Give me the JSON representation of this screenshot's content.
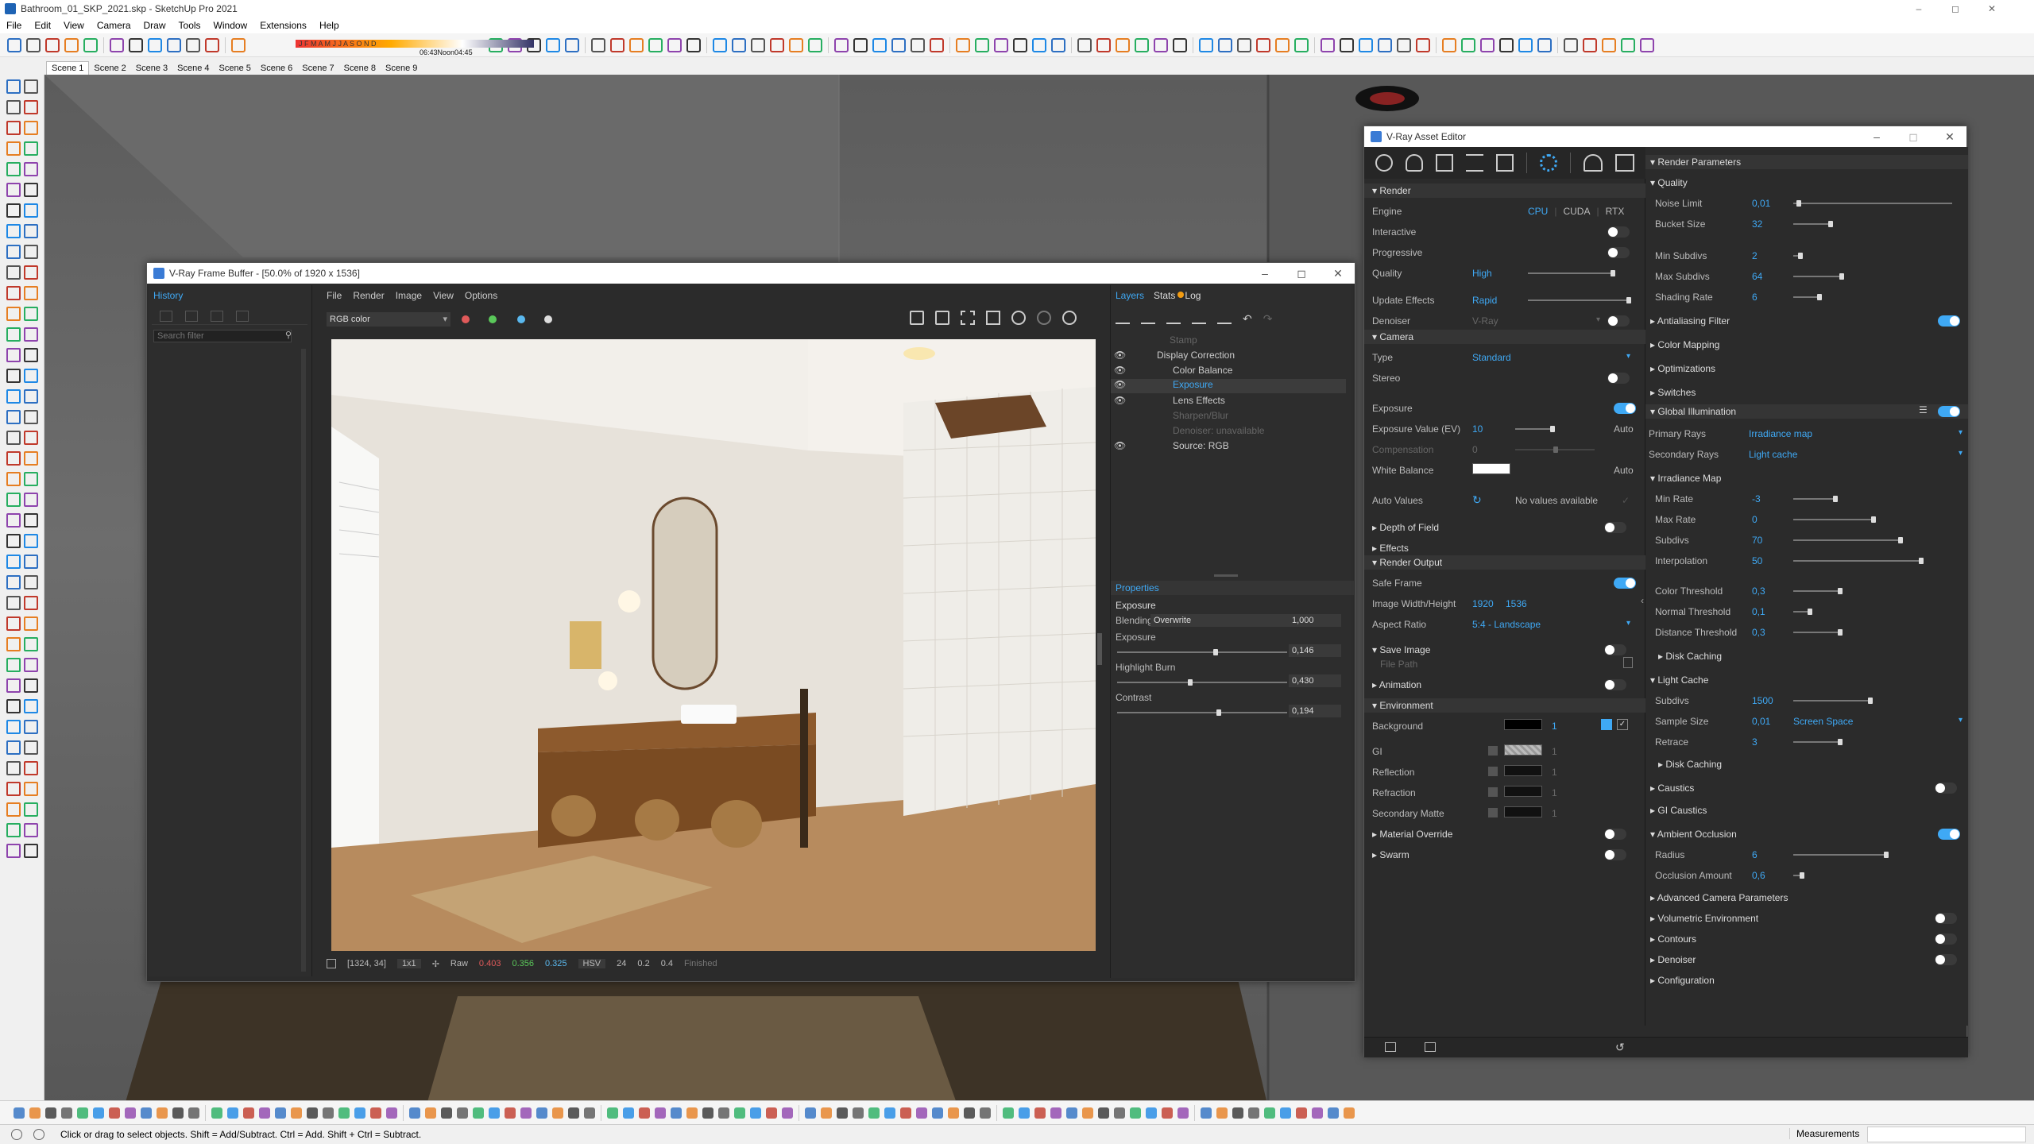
{
  "app": {
    "title": "Bathroom_01_SKP_2021.skp - SketchUp Pro 2021",
    "menu": [
      "File",
      "Edit",
      "View",
      "Camera",
      "Draw",
      "Tools",
      "Window",
      "Extensions",
      "Help"
    ],
    "shadow_months": "J F M A M J J A S O N D",
    "shadow_time_start": "06:43 AM",
    "shadow_time_mid": "Noon",
    "shadow_time_end": "04:45 PM",
    "scenes": [
      "Scene 1",
      "Scene 2",
      "Scene 3",
      "Scene 4",
      "Scene 5",
      "Scene 6",
      "Scene 7",
      "Scene 8",
      "Scene 9"
    ],
    "status_text": "Click or drag to select objects. Shift = Add/Subtract. Ctrl = Add. Shift + Ctrl = Subtract.",
    "measurements_label": "Measurements",
    "colors": {
      "accent": "#3fa9f5",
      "dark_bg": "#2b2b2b",
      "viewport": "#666666"
    }
  },
  "vfb": {
    "title": "V-Ray Frame Buffer - [50.0% of 1920 x 1536]",
    "history_label": "History",
    "search_placeholder": "Search filter",
    "menu": [
      "File",
      "Render",
      "Image",
      "View",
      "Options"
    ],
    "channel": "RGB color",
    "tabs": {
      "layers": "Layers",
      "stats": "Stats",
      "log": "Log"
    },
    "layers": [
      {
        "name": "Stamp",
        "enabled": false
      },
      {
        "name": "Display Correction",
        "enabled": true
      },
      {
        "name": "Color Balance",
        "enabled": true
      },
      {
        "name": "Exposure",
        "enabled": true,
        "selected": true
      },
      {
        "name": "Lens Effects",
        "enabled": true
      },
      {
        "name": "Sharpen/Blur",
        "enabled": false
      },
      {
        "name": "Denoiser: unavailable",
        "enabled": false
      },
      {
        "name": "Source: RGB",
        "enabled": true
      }
    ],
    "properties": {
      "header": "Properties",
      "section": "Exposure",
      "blending_label": "Blending",
      "blending_value": "Overwrite",
      "blending_amount": "1,000",
      "exposure_label": "Exposure",
      "exposure_value": "0,146",
      "exposure_level": 0.58,
      "highlight_label": "Highlight Burn",
      "highlight_value": "0,430",
      "highlight_level": 0.43,
      "contrast_label": "Contrast",
      "contrast_value": "0,194",
      "contrast_level": 0.6
    },
    "statusbar": {
      "coords": "[1324, 34]",
      "zoom": "1x1",
      "raw": "Raw",
      "r": "0.403",
      "g": "0.356",
      "b": "0.325",
      "mode": "HSV",
      "v1": "24",
      "v2": "0.2",
      "v3": "0.4",
      "state": "Finished"
    }
  },
  "ae": {
    "title": "V-Ray Asset Editor",
    "left": {
      "render_header": "Render",
      "engine_label": "Engine",
      "engine_options": [
        "CPU",
        "CUDA",
        "RTX"
      ],
      "interactive_label": "Interactive",
      "progressive_label": "Progressive",
      "quality_label": "Quality",
      "quality_value": "High",
      "update_effects_label": "Update Effects",
      "update_effects_value": "Rapid",
      "denoiser_label": "Denoiser",
      "denoiser_value": "V-Ray",
      "camera_header": "Camera",
      "type_label": "Type",
      "type_value": "Standard",
      "stereo_label": "Stereo",
      "exposure_label": "Exposure",
      "ev_label": "Exposure Value (EV)",
      "ev_value": "10",
      "ev_auto": "Auto",
      "compensation_label": "Compensation",
      "compensation_value": "0",
      "wb_label": "White Balance",
      "wb_auto": "Auto",
      "auto_values_label": "Auto Values",
      "auto_values_text": "No values available",
      "dof_label": "Depth of Field",
      "effects_label": "Effects",
      "render_output_header": "Render Output",
      "safe_frame_label": "Safe Frame",
      "image_wh_label": "Image Width/Height",
      "image_w": "1920",
      "image_h": "1536",
      "aspect_label": "Aspect Ratio",
      "aspect_value": "5:4 - Landscape",
      "save_image_label": "Save Image",
      "file_path_label": "File Path",
      "animation_label": "Animation",
      "environment_header": "Environment",
      "background_label": "Background",
      "background_value": "1",
      "gi_label": "GI",
      "gi_value": "1",
      "reflection_label": "Reflection",
      "reflection_value": "1",
      "refraction_label": "Refraction",
      "refraction_value": "1",
      "secondary_matte_label": "Secondary Matte",
      "secondary_matte_value": "1",
      "material_override_label": "Material Override",
      "swarm_label": "Swarm"
    },
    "right": {
      "render_params_header": "Render Parameters",
      "quality_header": "Quality",
      "noise_limit_label": "Noise Limit",
      "noise_limit_value": "0,01",
      "bucket_size_label": "Bucket Size",
      "bucket_size_value": "32",
      "min_subdivs_label": "Min Subdivs",
      "min_subdivs_value": "2",
      "max_subdivs_label": "Max Subdivs",
      "max_subdivs_value": "64",
      "shading_rate_label": "Shading Rate",
      "shading_rate_value": "6",
      "antialiasing_label": "Antialiasing Filter",
      "color_mapping_label": "Color Mapping",
      "optimizations_label": "Optimizations",
      "switches_label": "Switches",
      "gi_header": "Global Illumination",
      "primary_rays_label": "Primary Rays",
      "primary_rays_value": "Irradiance map",
      "secondary_rays_label": "Secondary Rays",
      "secondary_rays_value": "Light cache",
      "irradiance_header": "Irradiance Map",
      "min_rate_label": "Min Rate",
      "min_rate_value": "-3",
      "max_rate_label": "Max Rate",
      "max_rate_value": "0",
      "subdivs_label": "Subdivs",
      "subdivs_value": "70",
      "interpolation_label": "Interpolation",
      "interpolation_value": "50",
      "color_threshold_label": "Color Threshold",
      "color_threshold_value": "0,3",
      "normal_threshold_label": "Normal Threshold",
      "normal_threshold_value": "0,1",
      "distance_threshold_label": "Distance Threshold",
      "distance_threshold_value": "0,3",
      "disk_caching_label": "Disk Caching",
      "light_cache_header": "Light Cache",
      "lc_subdivs_label": "Subdivs",
      "lc_subdivs_value": "1500",
      "sample_size_label": "Sample Size",
      "sample_size_value": "0,01",
      "sample_space_value": "Screen Space",
      "retrace_label": "Retrace",
      "retrace_value": "3",
      "lc_disk_caching_label": "Disk Caching",
      "caustics_label": "Caustics",
      "gi_caustics_label": "GI Caustics",
      "ao_header": "Ambient Occlusion",
      "radius_label": "Radius",
      "radius_value": "6",
      "occlusion_amount_label": "Occlusion Amount",
      "occlusion_amount_value": "0,6",
      "adv_camera_label": "Advanced Camera Parameters",
      "vol_env_label": "Volumetric Environment",
      "contours_label": "Contours",
      "denoiser_label": "Denoiser",
      "configuration_label": "Configuration"
    }
  }
}
